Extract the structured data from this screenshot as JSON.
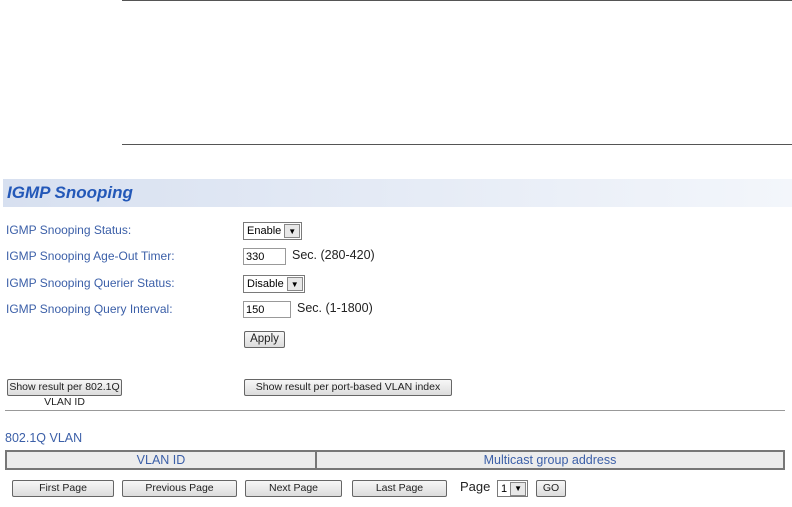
{
  "title": "IGMP Snooping",
  "fields": [
    {
      "label": "IGMP Snooping Status:",
      "value": "Enable"
    },
    {
      "label": "IGMP Snooping Age-Out Timer:",
      "value": "330",
      "unit": "Sec. (280-420)"
    },
    {
      "label": "IGMP Snooping Querier Status:",
      "value": "Disable"
    },
    {
      "label": "IGMP Snooping Query Interval:",
      "value": "150",
      "unit": "Sec. (1-1800)"
    }
  ],
  "apply": "Apply",
  "show_8021q": "Show result per 802.1Q VLAN ID",
  "show_port": "Show result per port-based VLAN index",
  "section": "802.1Q VLAN",
  "columns": [
    "VLAN ID",
    "Multicast group address"
  ],
  "pager": {
    "first": "First Page",
    "prev": "Previous Page",
    "next": "Next Page",
    "last": "Last Page",
    "page_label": "Page",
    "page": "1",
    "go": "GO"
  }
}
